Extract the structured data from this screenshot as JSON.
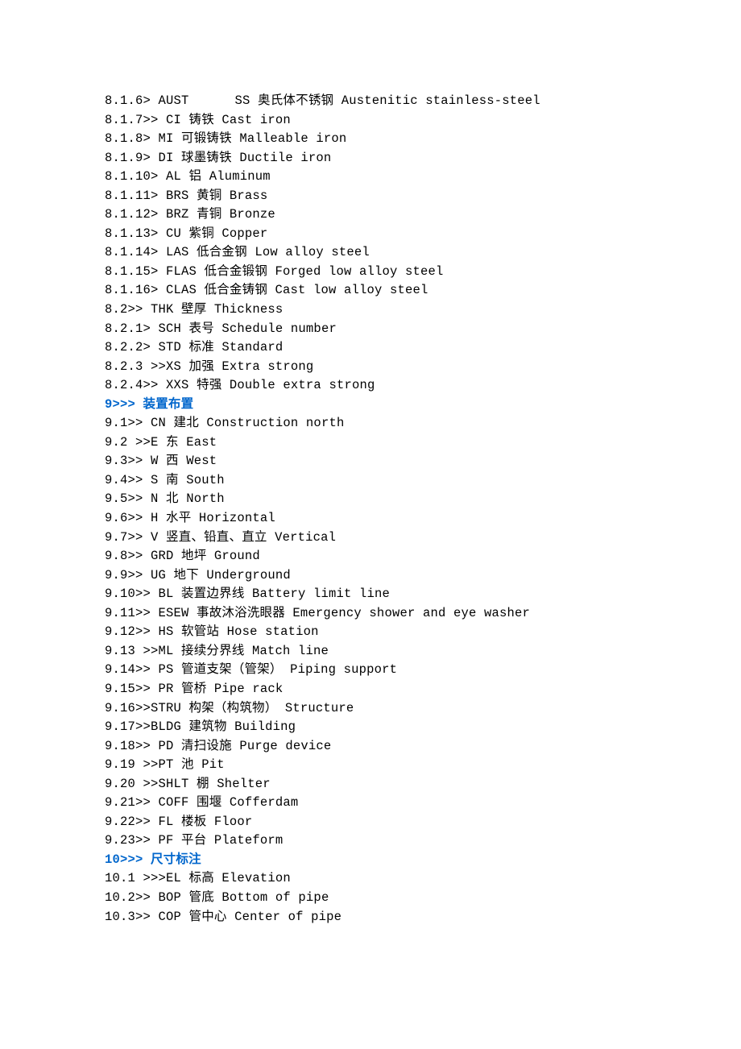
{
  "lines": [
    {
      "text": "8.1.6> AUST      SS 奥氏体不锈钢 Austenitic stainless-steel",
      "cls": "line"
    },
    {
      "text": "8.1.7>> CI 铸铁 Cast iron",
      "cls": "line"
    },
    {
      "text": "8.1.8> MI 可锻铸铁 Malleable iron",
      "cls": "line"
    },
    {
      "text": "8.1.9> DI 球墨铸铁 Ductile iron",
      "cls": "line"
    },
    {
      "text": "8.1.10> AL 铝 Aluminum",
      "cls": "line"
    },
    {
      "text": "8.1.11> BRS 黄铜 Brass",
      "cls": "line"
    },
    {
      "text": "8.1.12> BRZ 青铜 Bronze",
      "cls": "line"
    },
    {
      "text": "8.1.13> CU 紫铜 Copper",
      "cls": "line"
    },
    {
      "text": "8.1.14> LAS 低合金钢 Low alloy steel",
      "cls": "line"
    },
    {
      "text": "8.1.15> FLAS 低合金锻钢 Forged low alloy steel",
      "cls": "line"
    },
    {
      "text": "8.1.16> CLAS 低合金铸钢 Cast low alloy steel",
      "cls": "line"
    },
    {
      "text": "8.2>> THK 壁厚 Thickness",
      "cls": "line"
    },
    {
      "text": "8.2.1> SCH 表号 Schedule number",
      "cls": "line"
    },
    {
      "text": "8.2.2> STD 标准 Standard",
      "cls": "line"
    },
    {
      "text": "8.2.3 >>XS 加强 Extra strong",
      "cls": "line"
    },
    {
      "text": "8.2.4>> XXS 特强 Double extra strong",
      "cls": "line"
    },
    {
      "text": "9>>> 装置布置",
      "cls": "line heading"
    },
    {
      "text": "9.1>> CN 建北 Construction north",
      "cls": "line"
    },
    {
      "text": "9.2 >>E 东 East",
      "cls": "line"
    },
    {
      "text": "9.3>> W 西 West",
      "cls": "line"
    },
    {
      "text": "9.4>> S 南 South",
      "cls": "line"
    },
    {
      "text": "9.5>> N 北 North",
      "cls": "line"
    },
    {
      "text": "9.6>> H 水平 Horizontal",
      "cls": "line"
    },
    {
      "text": "9.7>> V 竖直、铅直、直立 Vertical",
      "cls": "line"
    },
    {
      "text": "9.8>> GRD 地坪 Ground",
      "cls": "line"
    },
    {
      "text": "9.9>> UG 地下 Underground",
      "cls": "line"
    },
    {
      "text": "9.10>> BL 装置边界线 Battery limit line",
      "cls": "line"
    },
    {
      "text": "9.11>> ESEW 事故沐浴洗眼器 Emergency shower and eye washer",
      "cls": "line"
    },
    {
      "text": "9.12>> HS 软管站 Hose station",
      "cls": "line"
    },
    {
      "text": "9.13 >>ML 接续分界线 Match line",
      "cls": "line"
    },
    {
      "text": "9.14>> PS 管道支架（管架） Piping support",
      "cls": "line"
    },
    {
      "text": "9.15>> PR 管桥 Pipe rack",
      "cls": "line"
    },
    {
      "text": "9.16>>STRU 构架（构筑物） Structure",
      "cls": "line"
    },
    {
      "text": "9.17>>BLDG 建筑物 Building",
      "cls": "line"
    },
    {
      "text": "9.18>> PD 清扫设施 Purge device",
      "cls": "line"
    },
    {
      "text": "9.19 >>PT 池 Pit",
      "cls": "line"
    },
    {
      "text": "9.20 >>SHLT 棚 Shelter",
      "cls": "line"
    },
    {
      "text": "9.21>> COFF 围堰 Cofferdam",
      "cls": "line"
    },
    {
      "text": "9.22>> FL 楼板 Floor",
      "cls": "line"
    },
    {
      "text": "9.23>> PF 平台 Plateform",
      "cls": "line"
    },
    {
      "text": "10>>> 尺寸标注",
      "cls": "line heading"
    },
    {
      "text": "10.1 >>>EL 标高 Elevation",
      "cls": "line"
    },
    {
      "text": "10.2>> BOP 管底 Bottom of pipe",
      "cls": "line"
    },
    {
      "text": "10.3>> COP 管中心 Center of pipe",
      "cls": "line"
    }
  ]
}
